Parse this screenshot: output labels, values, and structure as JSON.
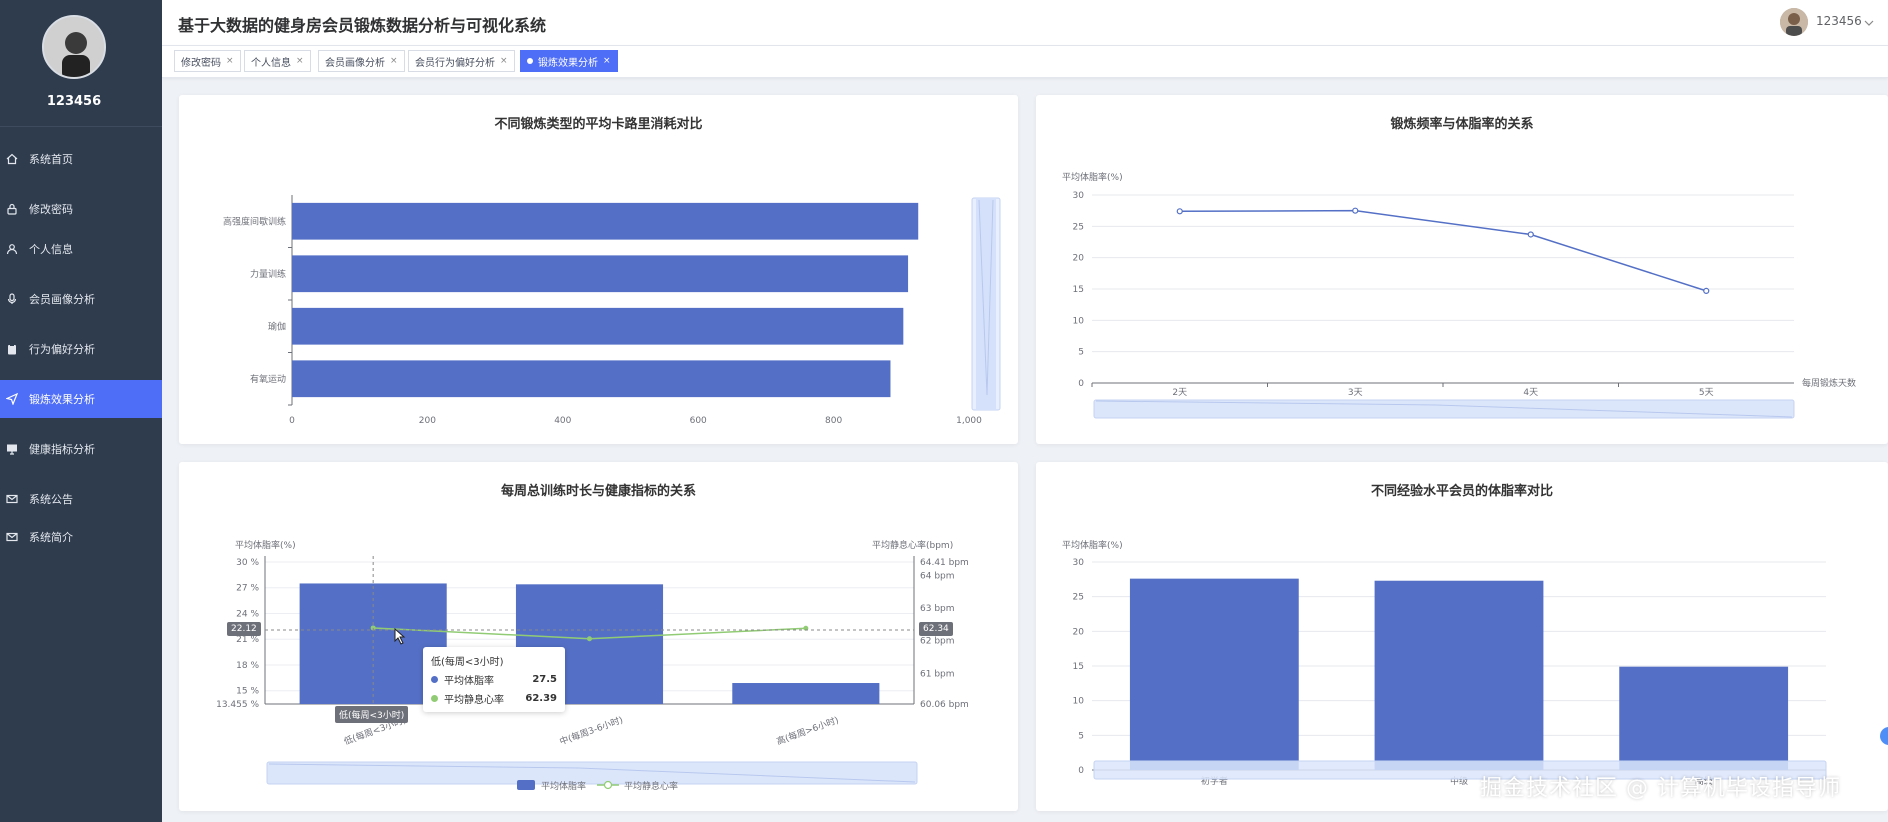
{
  "sidebar": {
    "username": "123456",
    "menu": [
      {
        "label": "系统首页",
        "icon": "home-icon"
      },
      {
        "label": "修改密码",
        "icon": "lock-icon"
      },
      {
        "label": "个人信息",
        "icon": "user-icon"
      },
      {
        "label": "会员画像分析",
        "icon": "microphone-icon"
      },
      {
        "label": "行为偏好分析",
        "icon": "clipboard-icon"
      },
      {
        "label": "锻炼效果分析",
        "icon": "send-icon"
      },
      {
        "label": "健康指标分析",
        "icon": "monitor-icon"
      },
      {
        "label": "系统公告",
        "icon": "mail-icon"
      },
      {
        "label": "系统简介",
        "icon": "mail-icon"
      }
    ],
    "active_index": 5
  },
  "header": {
    "title": "基于大数据的健身房会员锻炼数据分析与可视化系统",
    "user_name": "123456"
  },
  "tabs": [
    {
      "label": "修改密码",
      "active": false
    },
    {
      "label": "个人信息",
      "active": false
    },
    {
      "label": "会员画像分析",
      "active": false
    },
    {
      "label": "会员行为偏好分析",
      "active": false
    },
    {
      "label": "锻炼效果分析",
      "active": true
    }
  ],
  "colors": {
    "accent": "#4f6ef7",
    "bar": "#5470c6",
    "line_green": "#91cc75",
    "sidebar_bg": "#2f3c4e"
  },
  "charts": {
    "calories": {
      "title": "不同锻炼类型的平均卡路里消耗对比"
    },
    "frequency": {
      "title": "锻炼频率与体脂率的关系",
      "y_axis_name": "平均体脂率(%)",
      "x_axis_name": "每周锻炼天数"
    },
    "duration": {
      "title": "每周总训练时长与健康指标的关系",
      "y_left_name": "平均体脂率(%)",
      "y_right_name": "平均静息心率(bpm)",
      "pointer_left": "22.12",
      "pointer_right": "62.34",
      "pointer_x": "低(每周<3小时)",
      "tooltip": {
        "title": "低(每周<3小时)",
        "rows": [
          {
            "name": "平均体脂率",
            "value": "27.5",
            "color": "#5470c6"
          },
          {
            "name": "平均静息心率",
            "value": "62.39",
            "color": "#91cc75"
          }
        ]
      }
    },
    "experience": {
      "title": "不同经验水平会员的体脂率对比",
      "y_axis_name": "平均体脂率(%)"
    }
  },
  "chart_data": [
    {
      "type": "bar",
      "orientation": "horizontal",
      "title": "不同锻炼类型的平均卡路里消耗对比",
      "categories": [
        "有氧运动",
        "瑜伽",
        "力量训练",
        "高强度间歇训练"
      ],
      "values": [
        884,
        903,
        910,
        925
      ],
      "xlim": [
        0,
        1000
      ],
      "x_ticks": [
        "0",
        "200",
        "400",
        "600",
        "800",
        "1,000"
      ],
      "grid": false
    },
    {
      "type": "line",
      "title": "锻炼频率与体脂率的关系",
      "x": [
        "2天",
        "3天",
        "4天",
        "5天"
      ],
      "values": [
        27.4,
        27.5,
        23.7,
        14.7
      ],
      "ylim": [
        0,
        30
      ],
      "y_ticks": [
        "0",
        "5",
        "10",
        "15",
        "20",
        "25",
        "30"
      ],
      "xlabel": "每周锻炼天数",
      "ylabel": "平均体脂率(%)",
      "grid": true
    },
    {
      "type": "bar",
      "title": "每周总训练时长与健康指标的关系",
      "categories": [
        "低(每周<3小时)",
        "中(每周3-6小时)",
        "高(每周>6小时)"
      ],
      "series": [
        {
          "name": "平均体脂率",
          "type": "bar",
          "values": [
            27.5,
            27.4,
            15.9
          ],
          "axis": "left"
        },
        {
          "name": "平均静息心率",
          "type": "line",
          "values": [
            62.39,
            62.06,
            62.38
          ],
          "axis": "right"
        }
      ],
      "y_left_lim": [
        13.455,
        30
      ],
      "y_left_ticks": [
        "13.455 %",
        "15 %",
        "18 %",
        "21 %",
        "24 %",
        "27 %",
        "30 %"
      ],
      "y_right_lim": [
        60.06,
        64.41
      ],
      "y_right_ticks": [
        "60.06 bpm",
        "61 bpm",
        "62 bpm",
        "63 bpm",
        "64 bpm",
        "64.41 bpm"
      ],
      "legend": [
        "平均体脂率",
        "平均静息心率"
      ],
      "legend_position": "bottom"
    },
    {
      "type": "bar",
      "title": "不同经验水平会员的体脂率对比",
      "categories": [
        "初学者",
        "中级",
        "高级"
      ],
      "values": [
        27.6,
        27.3,
        14.9
      ],
      "ylim": [
        0,
        30
      ],
      "y_ticks": [
        "0",
        "5",
        "10",
        "15",
        "20",
        "25",
        "30"
      ],
      "ylabel": "平均体脂率(%)",
      "grid": true
    }
  ],
  "watermark": "掘金技术社区 @ 计算机毕设指导师"
}
